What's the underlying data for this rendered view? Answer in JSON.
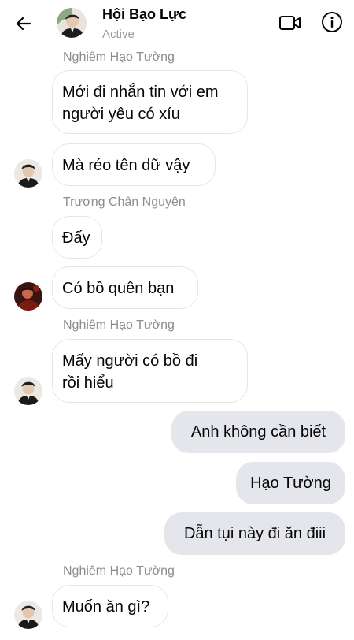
{
  "header": {
    "title": "Hội Bạo Lực",
    "status": "Active",
    "back_icon": "arrow-left-icon",
    "video_icon": "video-camera-icon",
    "info_icon": "info-icon"
  },
  "messages": [
    {
      "sender": "Nghiêm Hạo Tường"
    },
    {
      "text": "Mới đi nhắn tin với em\nngười yêu có xíu"
    },
    {
      "text": "Mà réo tên dữ vậy"
    },
    {
      "sender": "Trương Chân Nguyên"
    },
    {
      "text": "Đấy"
    },
    {
      "text": "Có bồ quên bạn"
    },
    {
      "sender": "Nghiêm Hạo Tường"
    },
    {
      "text": "Mấy người có bồ đi\nrồi hiểu"
    },
    {
      "text": "Anh không cần biết"
    },
    {
      "text": "Hạo Tường"
    },
    {
      "text": "Dẫn tụi này đi ăn điii"
    },
    {
      "sender": "Nghiêm Hạo Tường"
    },
    {
      "text": "Muốn ăn gì?"
    }
  ],
  "colors": {
    "outgoing_bubble": "#e4e6eb",
    "incoming_border": "#e6e6e6",
    "sender_label": "#8a8d91",
    "status_text": "#9a9a9a"
  }
}
